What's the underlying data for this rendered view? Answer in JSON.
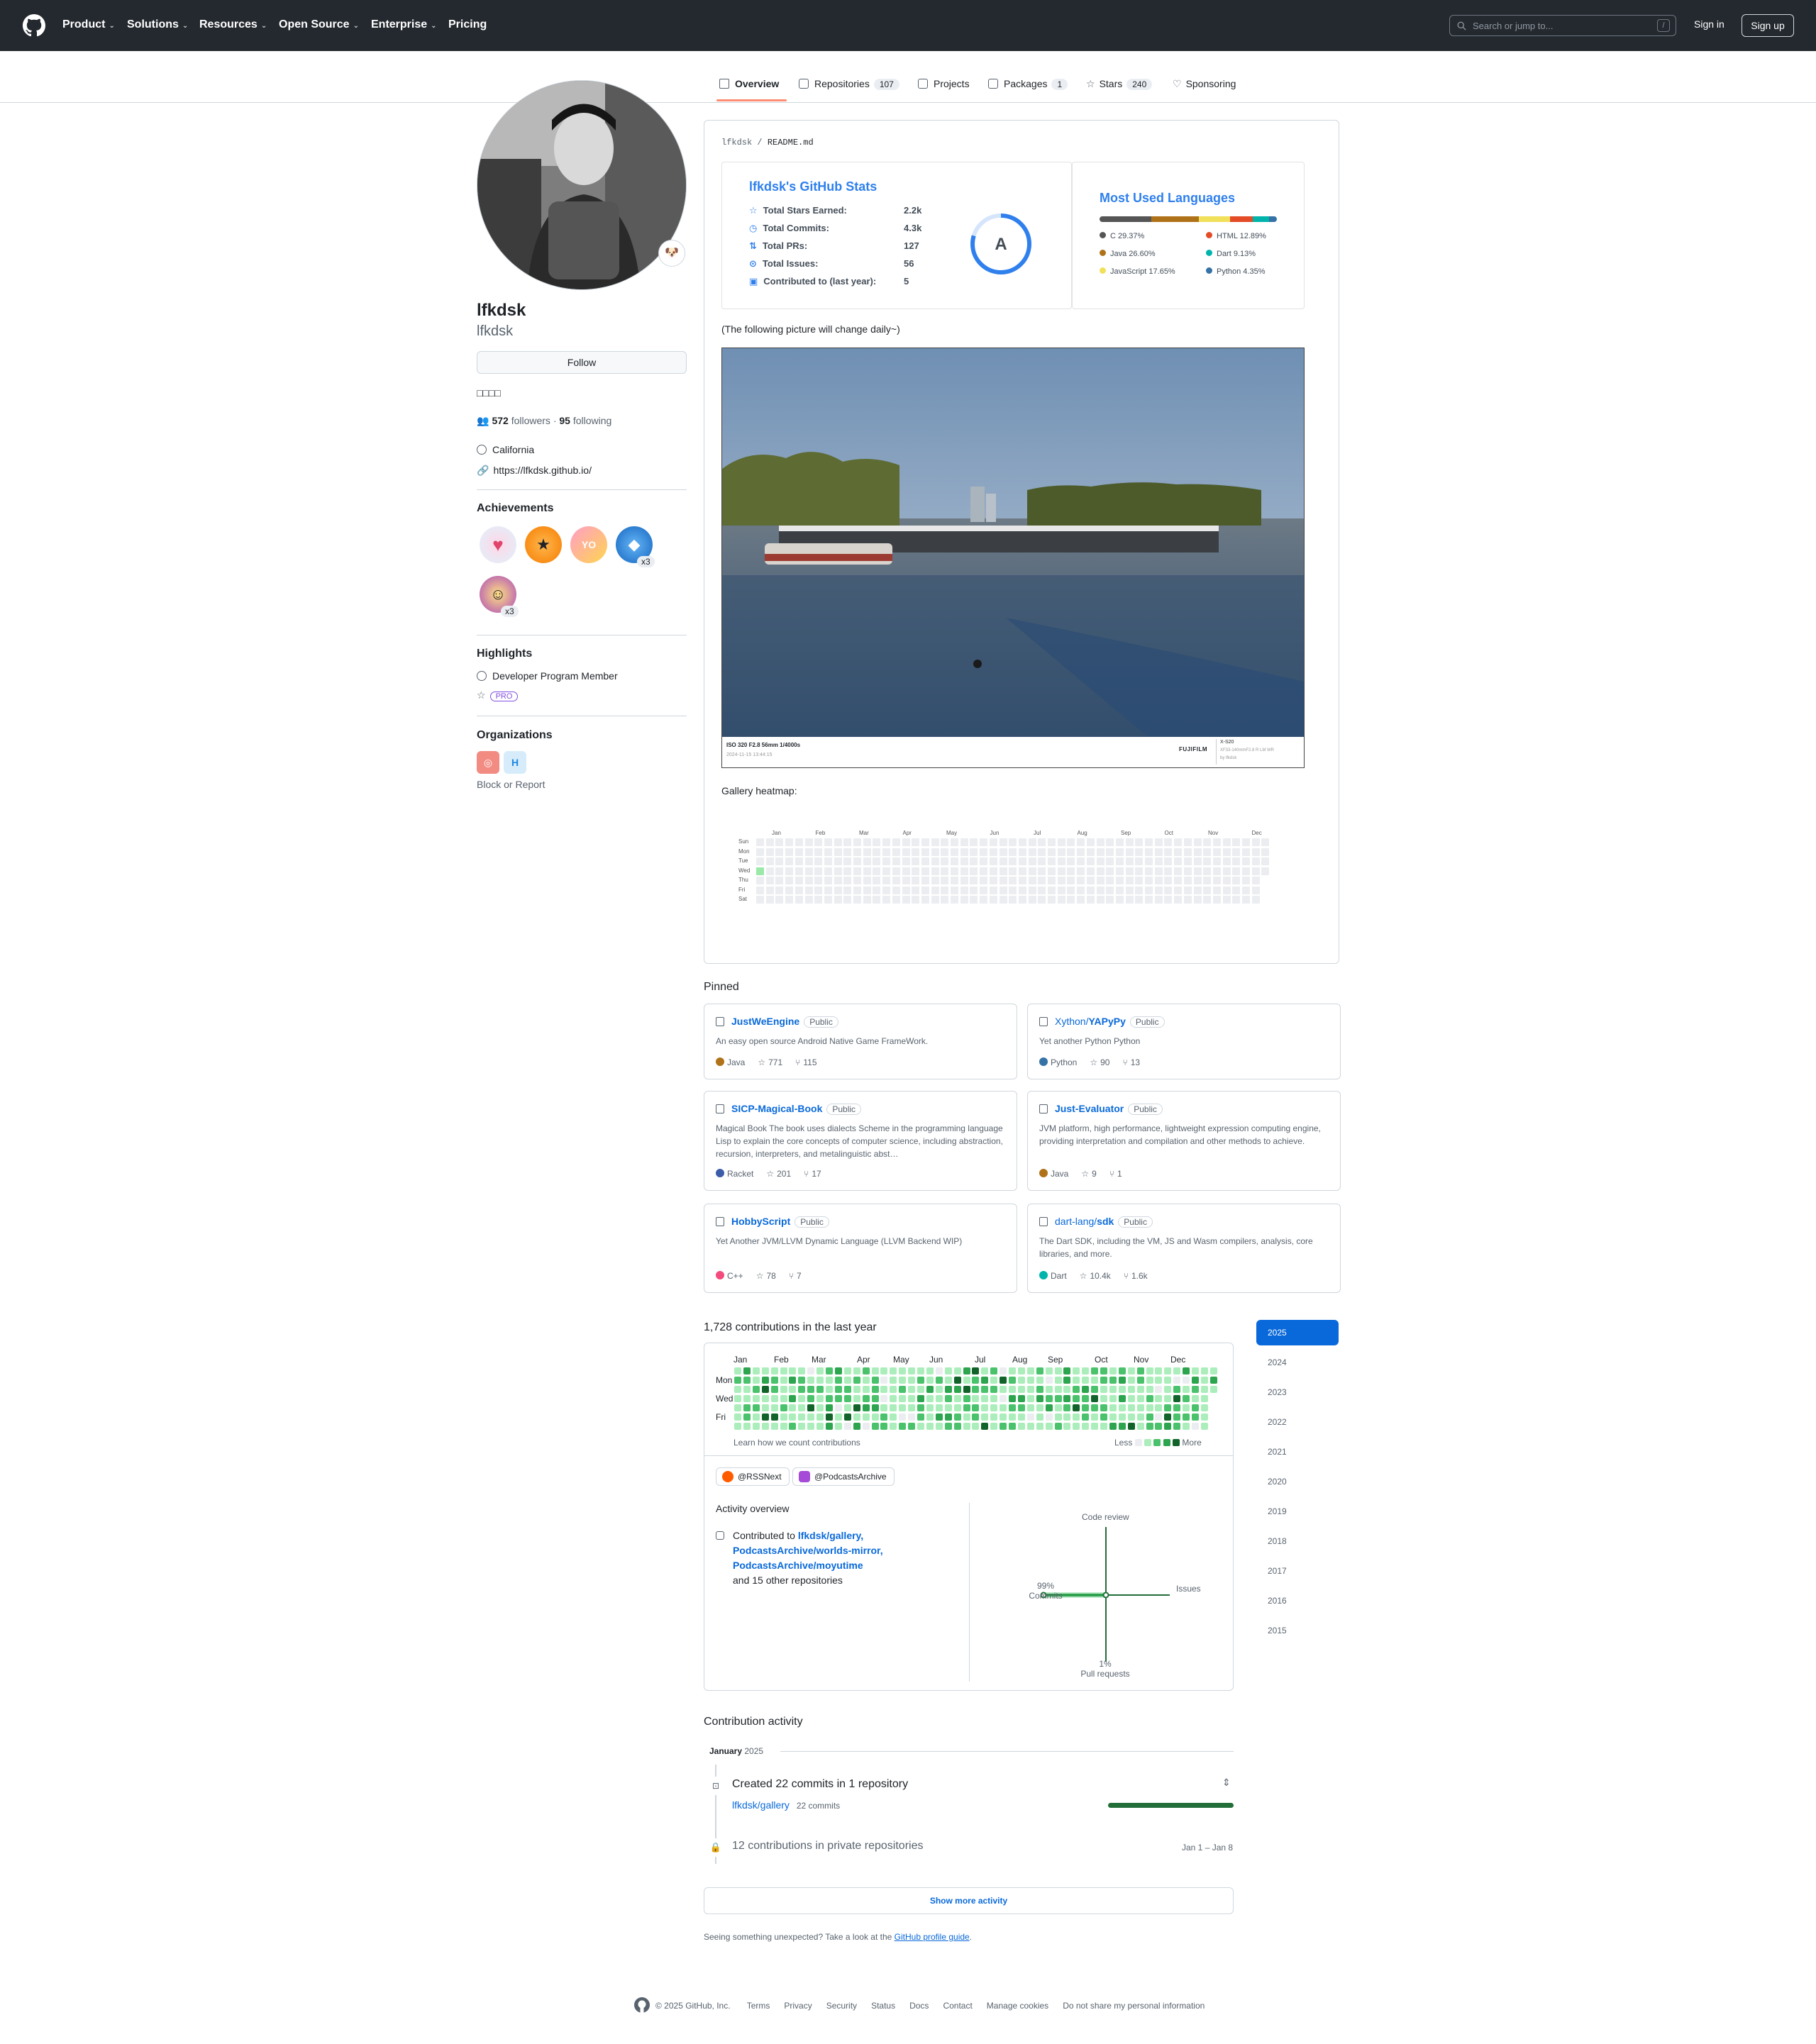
{
  "header": {
    "nav": [
      "Product",
      "Solutions",
      "Resources",
      "Open Source",
      "Enterprise",
      "Pricing"
    ],
    "search_placeholder": "Search or jump to...",
    "search_key": "/",
    "signin": "Sign in",
    "signup": "Sign up"
  },
  "tabs": [
    {
      "label": "Overview"
    },
    {
      "label": "Repositories",
      "count": "107"
    },
    {
      "label": "Projects"
    },
    {
      "label": "Packages",
      "count": "1"
    },
    {
      "label": "Stars",
      "count": "240"
    },
    {
      "label": "Sponsoring"
    }
  ],
  "profile": {
    "name": "lfkdsk",
    "login": "lfkdsk",
    "follow": "Follow",
    "bio": "□□□□",
    "followers": "572",
    "followers_label": "followers",
    "following": "95",
    "following_label": "following",
    "location": "California",
    "website": "https://lfkdsk.github.io/",
    "status_emoji": "🐶",
    "achievements_title": "Achievements",
    "achievement_badges": [
      "x3",
      "x3"
    ],
    "highlights_title": "Highlights",
    "highlight_member": "Developer Program Member",
    "pro": "PRO",
    "orgs_title": "Organizations",
    "block": "Block or Report"
  },
  "readme": {
    "path_owner": "lfkdsk",
    "path_sep": "/",
    "path_file": "README.md",
    "stats": {
      "title": "lfkdsk's GitHub Stats",
      "rows": [
        {
          "label": "Total Stars Earned:",
          "value": "2.2k"
        },
        {
          "label": "Total Commits:",
          "value": "4.3k"
        },
        {
          "label": "Total PRs:",
          "value": "127"
        },
        {
          "label": "Total Issues:",
          "value": "56"
        },
        {
          "label": "Contributed to (last year):",
          "value": "5"
        }
      ],
      "grade": "A"
    },
    "langs": {
      "title": "Most Used Languages",
      "items": [
        {
          "name": "C 29.37%",
          "pct": 29.37,
          "color": "#555555"
        },
        {
          "name": "Java 26.60%",
          "pct": 26.6,
          "color": "#b07219"
        },
        {
          "name": "JavaScript 17.65%",
          "pct": 17.65,
          "color": "#f1e05a"
        },
        {
          "name": "HTML 12.89%",
          "pct": 12.89,
          "color": "#e34c26"
        },
        {
          "name": "Dart 9.13%",
          "pct": 9.13,
          "color": "#00b4ab"
        },
        {
          "name": "Python 4.35%",
          "pct": 4.35,
          "color": "#3572A5"
        }
      ]
    },
    "picture_note": "(The following picture will change daily~)",
    "photo": {
      "exif": "ISO 320 F2.8 56mm 1/4000s",
      "date": "2024-11-15 13:44:15",
      "brand": "FUJIFILM",
      "camera": "X-S20",
      "lens": "XF33-140mmF2.8 R LM WR",
      "author": "by lfkdsk"
    },
    "heatmap_title": "Gallery heatmap:",
    "heatmap_months": [
      "Jan",
      "Feb",
      "Mar",
      "Apr",
      "May",
      "Jun",
      "Jul",
      "Aug",
      "Sep",
      "Oct",
      "Nov",
      "Dec"
    ],
    "heatmap_days": [
      "Sun",
      "Mon",
      "Tue",
      "Wed",
      "Thu",
      "Fri",
      "Sat"
    ]
  },
  "pinned": {
    "title": "Pinned",
    "items": [
      {
        "owner": "",
        "name": "JustWeEngine",
        "vis": "Public",
        "desc": "An easy open source Android Native Game FrameWork.",
        "lang": "Java",
        "color": "#b07219",
        "stars": "771",
        "forks": "115"
      },
      {
        "owner": "Xython/",
        "name": "YAPyPy",
        "vis": "Public",
        "desc": "Yet another Python Python",
        "lang": "Python",
        "color": "#3572A5",
        "stars": "90",
        "forks": "13"
      },
      {
        "owner": "",
        "name": "SICP-Magical-Book",
        "vis": "Public",
        "desc": "Magical Book The book uses dialects Scheme in the programming language Lisp to explain the core concepts of computer science, including abstraction, recursion, interpreters, and metalinguistic abst…",
        "lang": "Racket",
        "color": "#3c5caa",
        "stars": "201",
        "forks": "17"
      },
      {
        "owner": "",
        "name": "Just-Evaluator",
        "vis": "Public",
        "desc": "JVM platform, high performance, lightweight expression computing engine, providing interpretation and compilation and other methods to achieve.",
        "lang": "Java",
        "color": "#b07219",
        "stars": "9",
        "forks": "1"
      },
      {
        "owner": "",
        "name": "HobbyScript",
        "vis": "Public",
        "desc": "Yet Another JVM/LLVM Dynamic Language (LLVM Backend WIP)",
        "lang": "C++",
        "color": "#f34b7d",
        "stars": "78",
        "forks": "7"
      },
      {
        "owner": "dart-lang/",
        "name": "sdk",
        "vis": "Public",
        "desc": "The Dart SDK, including the VM, JS and Wasm compilers, analysis, core libraries, and more.",
        "lang": "Dart",
        "color": "#00B4AB",
        "stars": "10.4k",
        "forks": "1.6k"
      }
    ]
  },
  "contrib": {
    "title": "1,728 contributions in the last year",
    "months": [
      "Jan",
      "Feb",
      "Mar",
      "Apr",
      "May",
      "Jun",
      "Jul",
      "Aug",
      "Sep",
      "Oct",
      "Nov",
      "Dec"
    ],
    "days": [
      "Mon",
      "Wed",
      "Fri"
    ],
    "learn": "Learn how we count contributions",
    "less": "Less",
    "more": "More",
    "orgs": [
      "@RSSNext",
      "@PodcastsArchive"
    ],
    "overview_title": "Activity overview",
    "contributed_to": "Contributed to",
    "repos": [
      "lfkdsk/gallery,",
      "PodcastsArchive/worlds-mirror,",
      "PodcastsArchive/moyutime"
    ],
    "other": "and 15 other repositories",
    "axes": {
      "top": "Code review",
      "right": "Issues",
      "bottom_pct": "1%",
      "bottom": "Pull requests",
      "left_pct": "99%",
      "left": "Commits"
    },
    "years": [
      "2025",
      "2024",
      "2023",
      "2022",
      "2021",
      "2020",
      "2019",
      "2018",
      "2017",
      "2016",
      "2015"
    ]
  },
  "activity": {
    "title": "Contribution activity",
    "month": "January",
    "year": "2025",
    "created": "Created 22 commits in 1 repository",
    "repo": "lfkdsk/gallery",
    "repo_commits": "22 commits",
    "private": "12 contributions in private repositories",
    "range": "Jan 1 – Jan 8",
    "show_more": "Show more activity",
    "unexpected": "Seeing something unexpected? Take a look at the",
    "guide": "GitHub profile guide",
    "period": "."
  },
  "footer": {
    "copy": "© 2025 GitHub, Inc.",
    "links": [
      "Terms",
      "Privacy",
      "Security",
      "Status",
      "Docs",
      "Contact",
      "Manage cookies",
      "Do not share my personal information"
    ]
  }
}
